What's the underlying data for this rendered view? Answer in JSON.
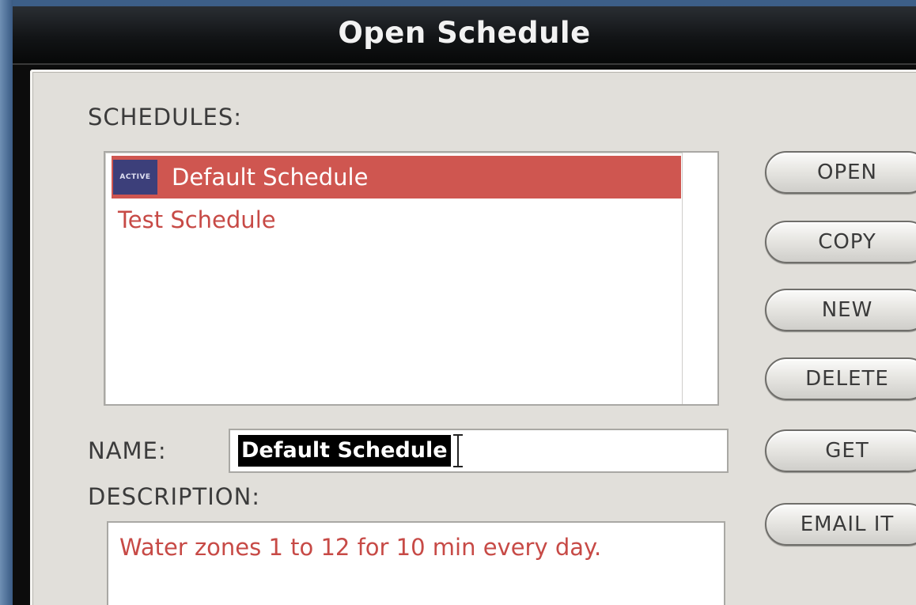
{
  "window": {
    "title": "Open Schedule"
  },
  "schedules": {
    "label": "SCHEDULES:",
    "items": [
      {
        "badge": "ACTIVE",
        "label": "Default Schedule",
        "selected": true
      },
      {
        "label": "Test Schedule",
        "selected": false
      }
    ]
  },
  "name": {
    "label": "NAME:",
    "value": "Default Schedule"
  },
  "description": {
    "label": "DESCRIPTION:",
    "value": "Water zones 1 to 12 for 10 min every day."
  },
  "buttons": {
    "open": "OPEN",
    "copy": "COPY",
    "new": "NEW",
    "delete": "DELETE",
    "get": "GET",
    "email": "EMAIL IT"
  },
  "colors": {
    "selection": "#cf5650",
    "item_text": "#c74a46",
    "badge": "#3c3f7a",
    "panel": "#e1dfda"
  }
}
